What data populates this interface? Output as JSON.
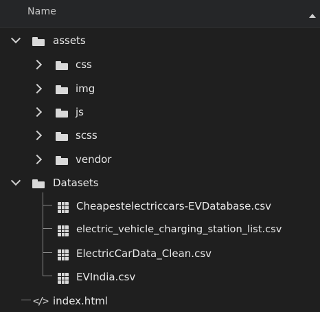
{
  "header": {
    "label": "Name",
    "sort_icon": "chevron-up-icon"
  },
  "tree": {
    "assets": {
      "label": "assets",
      "expanded": true,
      "children": [
        {
          "label": "css",
          "expanded": false
        },
        {
          "label": "img",
          "expanded": false
        },
        {
          "label": "js",
          "expanded": false
        },
        {
          "label": "scss",
          "expanded": false
        },
        {
          "label": "vendor",
          "expanded": false
        }
      ]
    },
    "datasets": {
      "label": "Datasets",
      "expanded": true,
      "files": [
        {
          "label": "Cheapestelectriccars-EVDatabase.csv",
          "icon": "table-icon"
        },
        {
          "label": "electric_vehicle_charging_station_list.csv",
          "icon": "table-icon"
        },
        {
          "label": "ElectricCarData_Clean.csv",
          "icon": "table-icon"
        },
        {
          "label": "EVIndia.csv",
          "icon": "table-icon"
        }
      ]
    },
    "index": {
      "label": "index.html",
      "icon": "code-icon"
    }
  }
}
